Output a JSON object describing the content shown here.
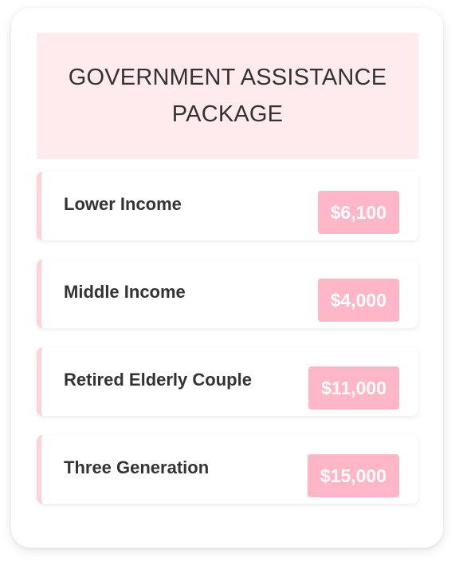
{
  "header": {
    "title": "GOVERNMENT ASSISTANCE PACKAGE"
  },
  "colors": {
    "header_bg": "#ffebee",
    "accent_border": "#ffd1d9",
    "amount_bg": "#ffb6c6",
    "text": "#333333"
  },
  "packages": [
    {
      "label": "Lower Income",
      "amount": "$6,100"
    },
    {
      "label": "Middle Income",
      "amount": "$4,000"
    },
    {
      "label": "Retired Elderly Couple",
      "amount": "$11,000"
    },
    {
      "label": "Three Generation",
      "amount": "$15,000"
    }
  ]
}
